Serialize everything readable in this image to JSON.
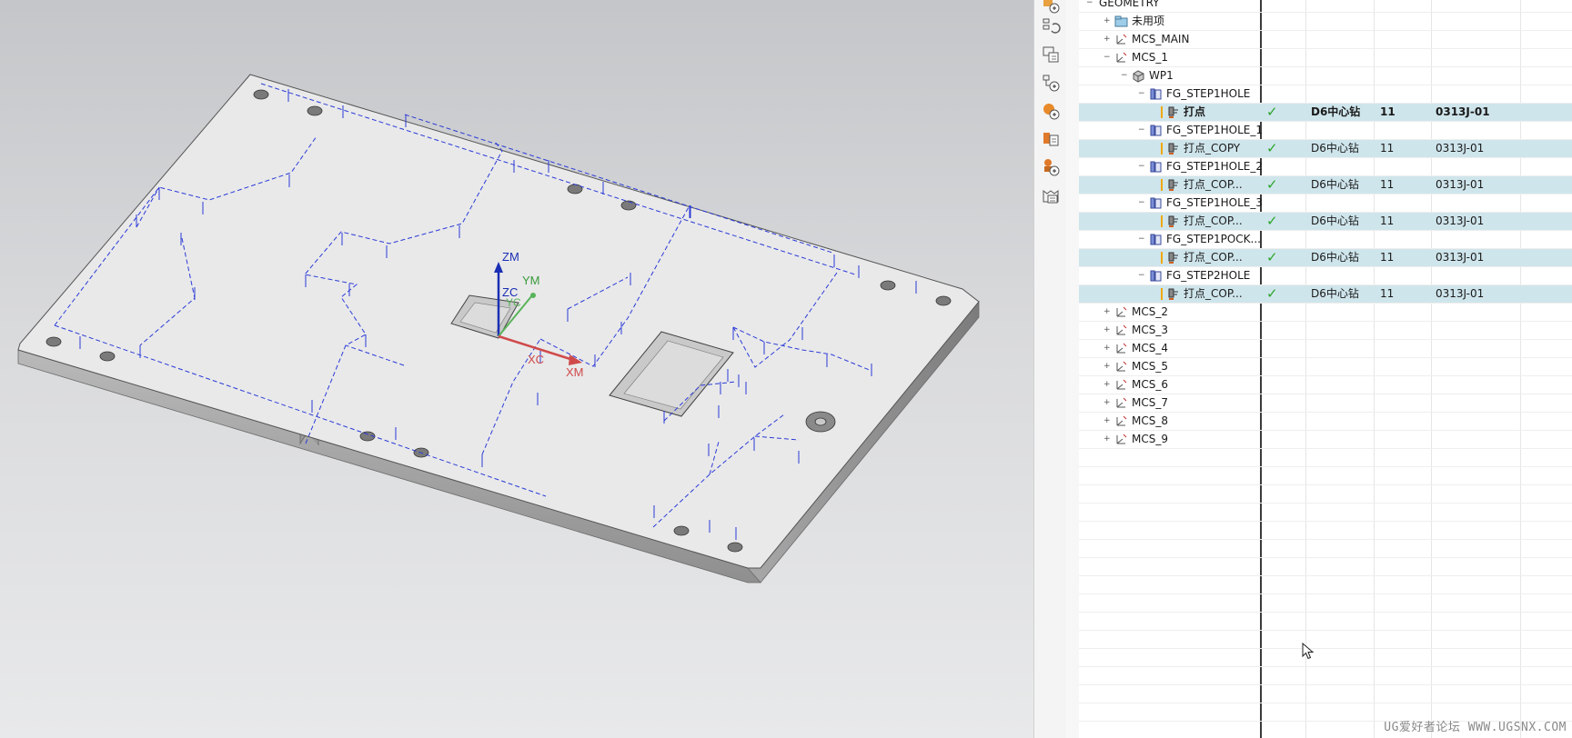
{
  "viewport": {
    "triad": {
      "zm": "ZM",
      "ym": "YM",
      "zc": "ZC",
      "yc": "YC",
      "xc": "XC",
      "xm": "XM"
    }
  },
  "tree": {
    "rows": [
      {
        "name": "GEOMETRY",
        "type": "root",
        "expand": "−"
      },
      {
        "name": "未用项",
        "type": "folder",
        "expand": "+"
      },
      {
        "name": "MCS_MAIN",
        "type": "mcs",
        "expand": "+"
      },
      {
        "name": "MCS_1",
        "type": "mcs",
        "expand": "−"
      },
      {
        "name": "WP1",
        "type": "workpiece",
        "expand": "−"
      },
      {
        "name": "FG_STEP1HOLE",
        "type": "feature-group",
        "expand": "−"
      },
      {
        "name": "打点",
        "type": "operation",
        "status": "✓",
        "tool": "D6中心钻",
        "num": "11",
        "program": "0313J-01",
        "bold": true
      },
      {
        "name": "FG_STEP1HOLE_1",
        "type": "feature-group",
        "expand": "−"
      },
      {
        "name": "打点_COPY",
        "type": "operation",
        "status": "✓",
        "tool": "D6中心钻",
        "num": "11",
        "program": "0313J-01"
      },
      {
        "name": "FG_STEP1HOLE_2",
        "type": "feature-group",
        "expand": "−"
      },
      {
        "name": "打点_COP...",
        "type": "operation",
        "status": "✓",
        "tool": "D6中心钻",
        "num": "11",
        "program": "0313J-01"
      },
      {
        "name": "FG_STEP1HOLE_3",
        "type": "feature-group",
        "expand": "−"
      },
      {
        "name": "打点_COP...",
        "type": "operation",
        "status": "✓",
        "tool": "D6中心钻",
        "num": "11",
        "program": "0313J-01"
      },
      {
        "name": "FG_STEP1POCK...",
        "type": "feature-group",
        "expand": "−"
      },
      {
        "name": "打点_COP...",
        "type": "operation",
        "status": "✓",
        "tool": "D6中心钻",
        "num": "11",
        "program": "0313J-01"
      },
      {
        "name": "FG_STEP2HOLE",
        "type": "feature-group",
        "expand": "−"
      },
      {
        "name": "打点_COP...",
        "type": "operation",
        "status": "✓",
        "tool": "D6中心钻",
        "num": "11",
        "program": "0313J-01"
      },
      {
        "name": "MCS_2",
        "type": "mcs",
        "expand": "+"
      },
      {
        "name": "MCS_3",
        "type": "mcs",
        "expand": "+"
      },
      {
        "name": "MCS_4",
        "type": "mcs",
        "expand": "+"
      },
      {
        "name": "MCS_5",
        "type": "mcs",
        "expand": "+"
      },
      {
        "name": "MCS_6",
        "type": "mcs",
        "expand": "+"
      },
      {
        "name": "MCS_7",
        "type": "mcs",
        "expand": "+"
      },
      {
        "name": "MCS_8",
        "type": "mcs",
        "expand": "+"
      },
      {
        "name": "MCS_9",
        "type": "mcs",
        "expand": "+"
      }
    ]
  },
  "toolbar": {
    "icons": [
      "create-program-icon",
      "refresh-icon",
      "tool-view-icon",
      "geometry-view-icon",
      "create-tool-icon",
      "method-view-icon",
      "create-method-icon",
      "machine-tool-icon"
    ]
  },
  "watermark": "UG爱好者论坛 WWW.UGSNX.COM",
  "colors": {
    "highlight": "#cfe5ec",
    "check": "#2aa52a",
    "toolpath": "#2b3bd6",
    "warn": "#f0a800"
  }
}
